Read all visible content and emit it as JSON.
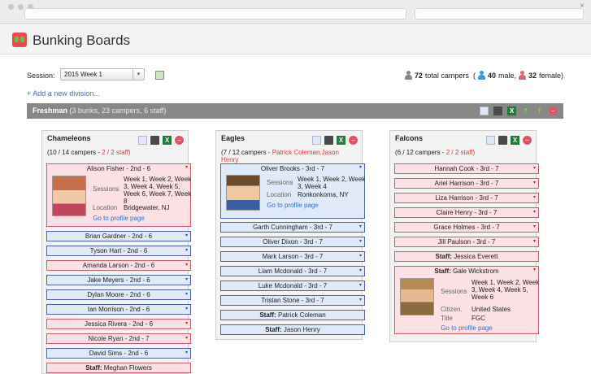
{
  "browser": {
    "url": "",
    "search": "",
    "close": "×"
  },
  "app": {
    "title": "Bunking Boards"
  },
  "session": {
    "label": "Session:",
    "value": "2015 Week 1"
  },
  "stats": {
    "total": "72",
    "total_label": "total campers",
    "male": "40",
    "male_label": "male,",
    "female": "32",
    "female_label": "female)"
  },
  "add_division": "+ Add a new division...",
  "division": {
    "name": "Freshman",
    "summary": "(3 bunks, 23 campers, 6 staff)"
  },
  "bunks": [
    {
      "name": "Chameleons",
      "campers": "(10 / 14 campers -",
      "staff": "2 / 2 staff)",
      "featured": {
        "name": "Alison Fisher - 2nd - 6",
        "sessions_label": "Sessions",
        "sessions": "Week 1, Week 2, Week 3, Week 4, Week 5, Week 6, Week 7, Week 8",
        "location_label": "Location",
        "location": "Bridgewater, NJ",
        "link": "Go to profile page"
      },
      "items": [
        "Brian Gardner - 2nd - 6",
        "Tyson Hart - 2nd - 6",
        "Amanda Larson - 2nd - 6",
        "Jake Meyers - 2nd - 6",
        "Dylan Moore - 2nd - 6",
        "Ian Morrison - 2nd - 6",
        "Jessica Rivera - 2nd - 6",
        "Nicole Ryan - 2nd - 7",
        "David Sims - 2nd - 6"
      ],
      "staff_label": "Staff:",
      "staff_name": "Meghan Flowers"
    },
    {
      "name": "Eagles",
      "campers": "(7 / 12 campers -",
      "staff": [
        "Patrick Coleman",
        "Jason Henry"
      ],
      "featured": {
        "name": "Oliver Brooks - 3rd - 7",
        "sessions_label": "Sessions",
        "sessions": "Week 1, Week 2, Week 3, Week 4",
        "location_label": "Location",
        "location": "Ronkonkoma, NY",
        "link": "Go to profile page"
      },
      "items": [
        "Garth Cunningham - 3rd - 7",
        "Oliver Dixon - 3rd - 7",
        "Mark Larson - 3rd - 7",
        "Liam Mcdonald - 3rd - 7",
        "Luke Mcdonald - 3rd - 7",
        "Tristan Stone - 3rd - 7"
      ],
      "staff_label": "Staff:"
    },
    {
      "name": "Falcons",
      "campers": "(6 / 12 campers -",
      "staff": "2 / 2 staff)",
      "items": [
        "Hannah Cook - 3rd - 7",
        "Ariel Harrison - 3rd - 7",
        "Liza Harrison - 3rd - 7",
        "Claire Henry - 3rd - 7",
        "Grace Holmes - 3rd - 7",
        "Jill Paulson - 3rd - 7"
      ],
      "staff_label": "Staff:",
      "staff_one": "Jessica Everett",
      "featured": {
        "name": "Gale Wickstrom",
        "sessions_label": "Sessions",
        "sessions": "Week 1, Week 2, Week 3, Week 4, Week 5, Week 6",
        "citizen_label": "Citizen.",
        "citizen": "United States",
        "title_label": "Title",
        "title": "FGC",
        "link": "Go to profile page"
      }
    }
  ],
  "icons": {
    "excel": "X",
    "up": "⇡",
    "del": "−",
    "dd": "▾"
  },
  "colors": {
    "female": "#fbe0e4",
    "male": "#dfe9f7",
    "division": "#888888",
    "link": "#3a6fc4",
    "staff_count": "#d43b3b"
  }
}
